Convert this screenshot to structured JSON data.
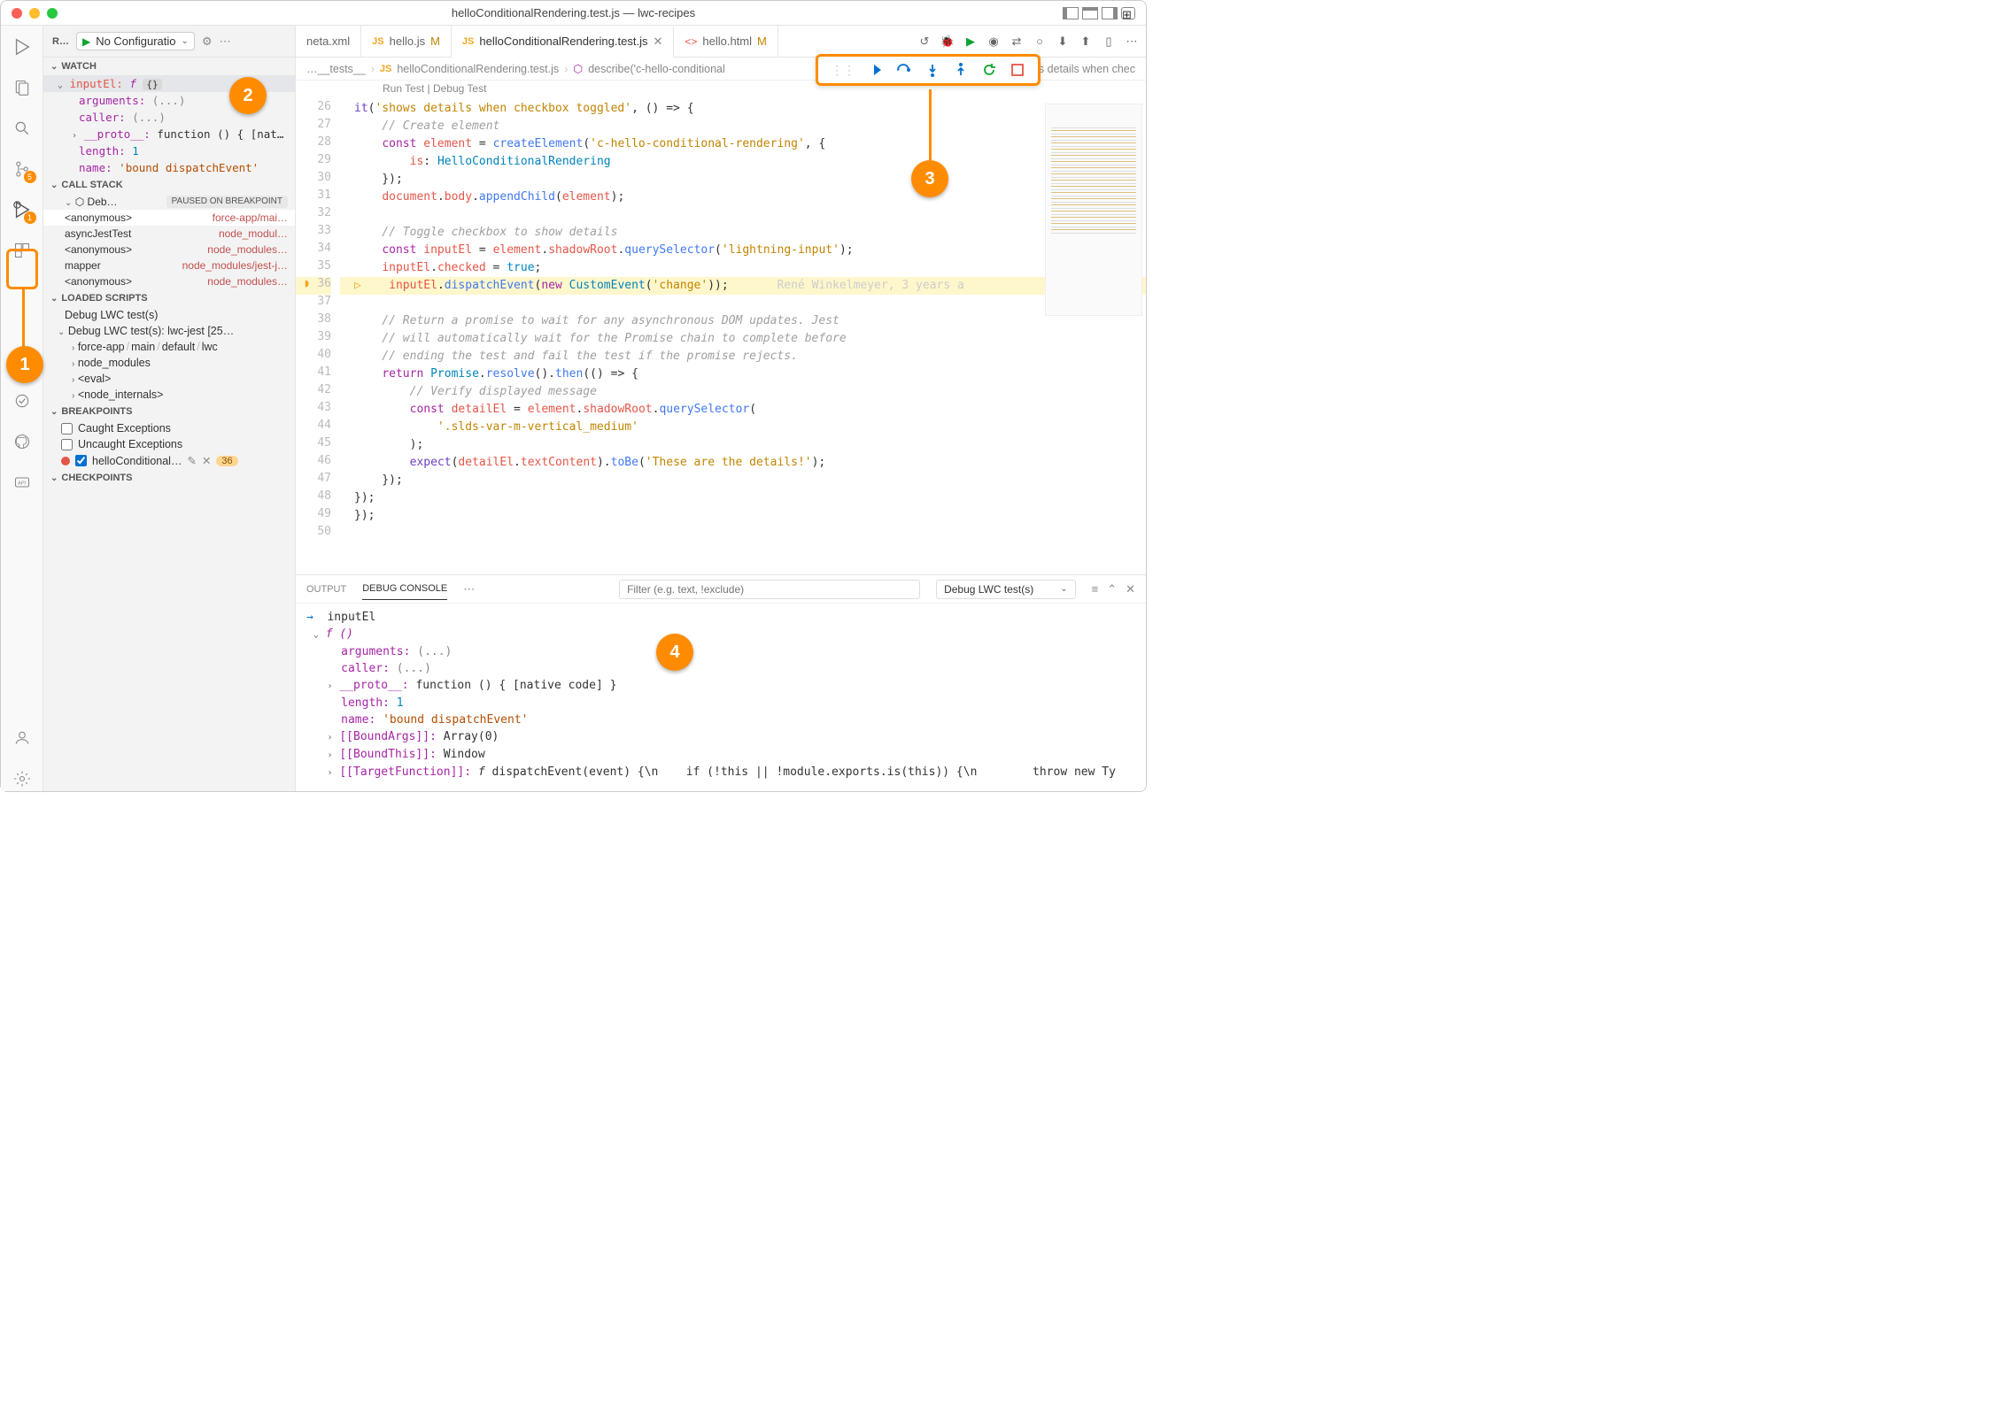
{
  "window": {
    "title": "helloConditionalRendering.test.js — lwc-recipes"
  },
  "activitybar_badge_scm": "5",
  "activitybar_badge_debug": "1",
  "sidebar": {
    "title": "R…",
    "config": "No Configuratio",
    "sections": {
      "watch": "Watch",
      "callstack": "Call Stack",
      "loaded": "Loaded Scripts",
      "breakpoints": "Breakpoints",
      "checkpoints": "Checkpoints"
    },
    "watch": {
      "root_label": "inputEl:",
      "root_type": "f",
      "root_badge": "{}",
      "arguments": "arguments:",
      "arguments_val": "(...)",
      "caller": "caller:",
      "caller_val": "(...)",
      "proto": "__proto__:",
      "proto_val": "function () { [nat…",
      "length": "length:",
      "length_val": "1",
      "name": "name:",
      "name_val": "'bound dispatchEvent'"
    },
    "stack": {
      "thread": "Deb…",
      "paused": "PAUSED ON BREAKPOINT",
      "frames": [
        {
          "fn": "<anonymous>",
          "src": "force-app/mai…"
        },
        {
          "fn": "asyncJestTest",
          "src": "node_modul…"
        },
        {
          "fn": "<anonymous>",
          "src": "node_modules…"
        },
        {
          "fn": "mapper",
          "src": "node_modules/jest-j…"
        },
        {
          "fn": "<anonymous>",
          "src": "node_modules…"
        }
      ]
    },
    "loaded": {
      "root1": "Debug LWC test(s)",
      "root2": "Debug LWC test(s): lwc-jest [25…",
      "children": [
        "force-app / main / default / lwc",
        "node_modules",
        "<eval>",
        "<node_internals>"
      ]
    },
    "breakpoints": {
      "caught": "Caught Exceptions",
      "uncaught": "Uncaught Exceptions",
      "file": "helloConditional…",
      "count": "36"
    }
  },
  "tabs": {
    "t0": "neta.xml",
    "t1": "hello.js",
    "t1_mod": "M",
    "t2": "helloConditionalRendering.test.js",
    "t3": "hello.html",
    "t3_mod": "M"
  },
  "breadcrumb": {
    "b0": "…__tests__",
    "b1": "helloConditionalRendering.test.js",
    "b2": "describe('c-hello-conditional",
    "b3": "'shows details when chec"
  },
  "codelens": {
    "run": "Run Test",
    "debug": "Debug Test",
    "sep": " | "
  },
  "code": {
    "lines_start": 26,
    "lines": [
      "it('shows details when checkbox toggled', () => {",
      "    // Create element",
      "    const element = createElement('c-hello-conditional-rendering', {",
      "        is: HelloConditionalRendering",
      "    });",
      "    document.body.appendChild(element);",
      "",
      "    // Toggle checkbox to show details",
      "    const inputEl = element.shadowRoot.querySelector('lightning-input');",
      "    inputEl.checked = true;",
      "    inputEl.dispatchEvent(new CustomEvent('change'));",
      "",
      "    // Return a promise to wait for any asynchronous DOM updates. Jest",
      "    // will automatically wait for the Promise chain to complete before",
      "    // ending the test and fail the test if the promise rejects.",
      "    return Promise.resolve().then(() => {",
      "        // Verify displayed message",
      "        const detailEl = element.shadowRoot.querySelector(",
      "            '.slds-var-m-vertical_medium'",
      "        );",
      "        expect(detailEl.textContent).toBe('These are the details!');",
      "    });",
      "});",
      "});",
      ""
    ],
    "blame": "René Winkelmeyer, 3 years a"
  },
  "panel": {
    "tabs": {
      "output": "Output",
      "debug": "Debug Console"
    },
    "filter_placeholder": "Filter (e.g. text, !exclude)",
    "select": "Debug LWC test(s)",
    "console": {
      "l0": "inputEl",
      "l1": "f ()",
      "l2": "arguments: (...)",
      "l3": "caller: (...)",
      "l4": "__proto__: function () { [native code] }",
      "l5": "length: 1",
      "l6": "name: 'bound dispatchEvent'",
      "l7": "[[BoundArgs]]: Array(0)",
      "l8": "[[BoundThis]]: Window",
      "l9": "[[TargetFunction]]: f dispatchEvent(event) {\\n    if (!this || !module.exports.is(this)) {\\n        throw new Ty"
    }
  },
  "callouts": {
    "c1": "1",
    "c2": "2",
    "c3": "3",
    "c4": "4"
  }
}
